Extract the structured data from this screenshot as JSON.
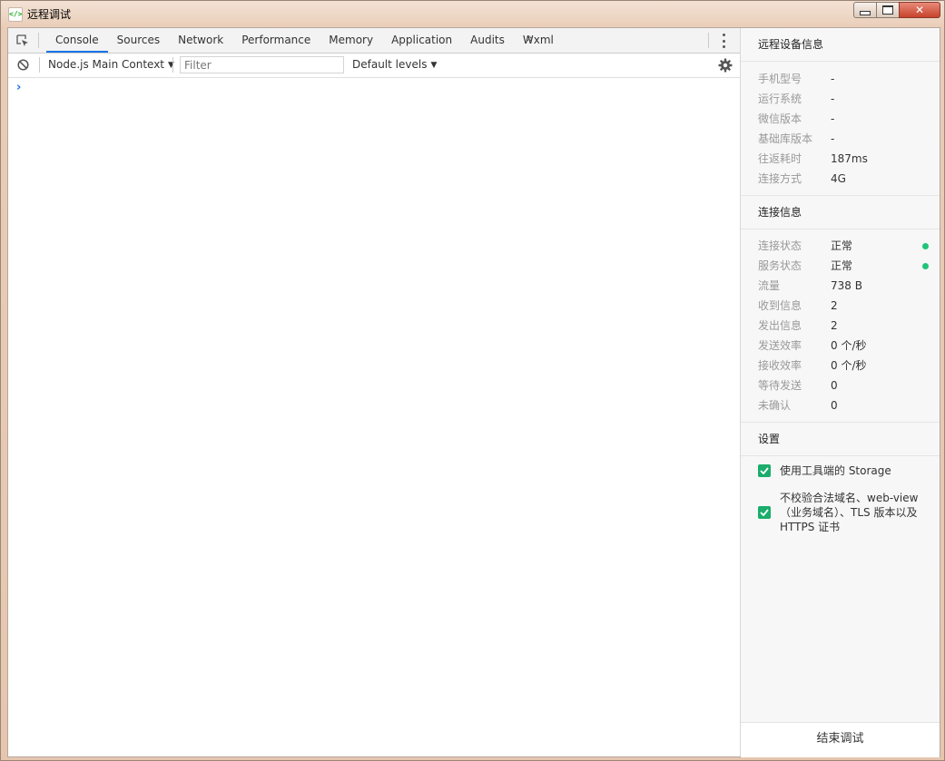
{
  "window": {
    "title": "远程调试",
    "icon": "code-brackets-icon",
    "close_glyph": "✕"
  },
  "devtools": {
    "tabs": [
      "Console",
      "Sources",
      "Network",
      "Performance",
      "Memory",
      "Application",
      "Audits",
      "Wxml"
    ],
    "more_tabs": "»",
    "context": "Node.js Main Context",
    "filter_placeholder": "Filter",
    "levels": "Default levels",
    "prompt": "›",
    "accent": "#1a73e8"
  },
  "side": {
    "device_title": "远程设备信息",
    "device": [
      {
        "k": "手机型号",
        "v": "-"
      },
      {
        "k": "运行系统",
        "v": "-"
      },
      {
        "k": "微信版本",
        "v": "-"
      },
      {
        "k": "基础库版本",
        "v": "-"
      },
      {
        "k": "往返耗时",
        "v": "187ms"
      },
      {
        "k": "连接方式",
        "v": "4G"
      }
    ],
    "conn_title": "连接信息",
    "conn": [
      {
        "k": "连接状态",
        "v": "正常",
        "dot": true
      },
      {
        "k": "服务状态",
        "v": "正常",
        "dot": true
      },
      {
        "k": "流量",
        "v": "738 B"
      },
      {
        "k": "收到信息",
        "v": "2"
      },
      {
        "k": "发出信息",
        "v": "2"
      },
      {
        "k": "发送效率",
        "v": "0 个/秒"
      },
      {
        "k": "接收效率",
        "v": "0 个/秒"
      },
      {
        "k": "等待发送",
        "v": "0"
      },
      {
        "k": "未确认",
        "v": "0"
      }
    ],
    "settings_title": "设置",
    "settings": [
      {
        "label": "使用工具端的 Storage",
        "checked": true
      },
      {
        "label": "不校验合法域名、web-view（业务域名）、TLS 版本以及 HTTPS 证书",
        "checked": true
      }
    ],
    "end_button": "结束调试",
    "status_color": "#21c47a",
    "check_color": "#1aad6b"
  }
}
